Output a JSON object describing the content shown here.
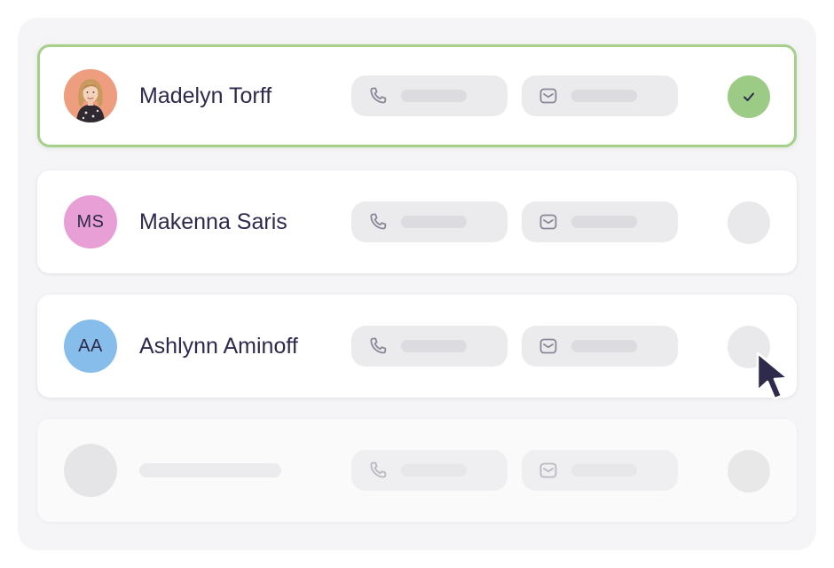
{
  "contacts": [
    {
      "name": "Madelyn Torff",
      "avatar_type": "photo",
      "selected": true
    },
    {
      "name": "Makenna Saris",
      "initials": "MS",
      "avatar_color": "#e79fd6",
      "selected": false
    },
    {
      "name": "Ashlynn Aminoff",
      "initials": "AA",
      "avatar_color": "#86bdea",
      "selected": false
    },
    {
      "placeholder": true
    }
  ],
  "icons": {
    "phone": "phone-icon",
    "mail": "mail-icon",
    "check": "checkmark-icon",
    "cursor": "mouse-pointer-icon"
  },
  "colors": {
    "selected_border": "#a5cf8b",
    "check_fill": "#9ccb86",
    "text": "#2d2a4c",
    "pill_bg": "#ebebee"
  }
}
